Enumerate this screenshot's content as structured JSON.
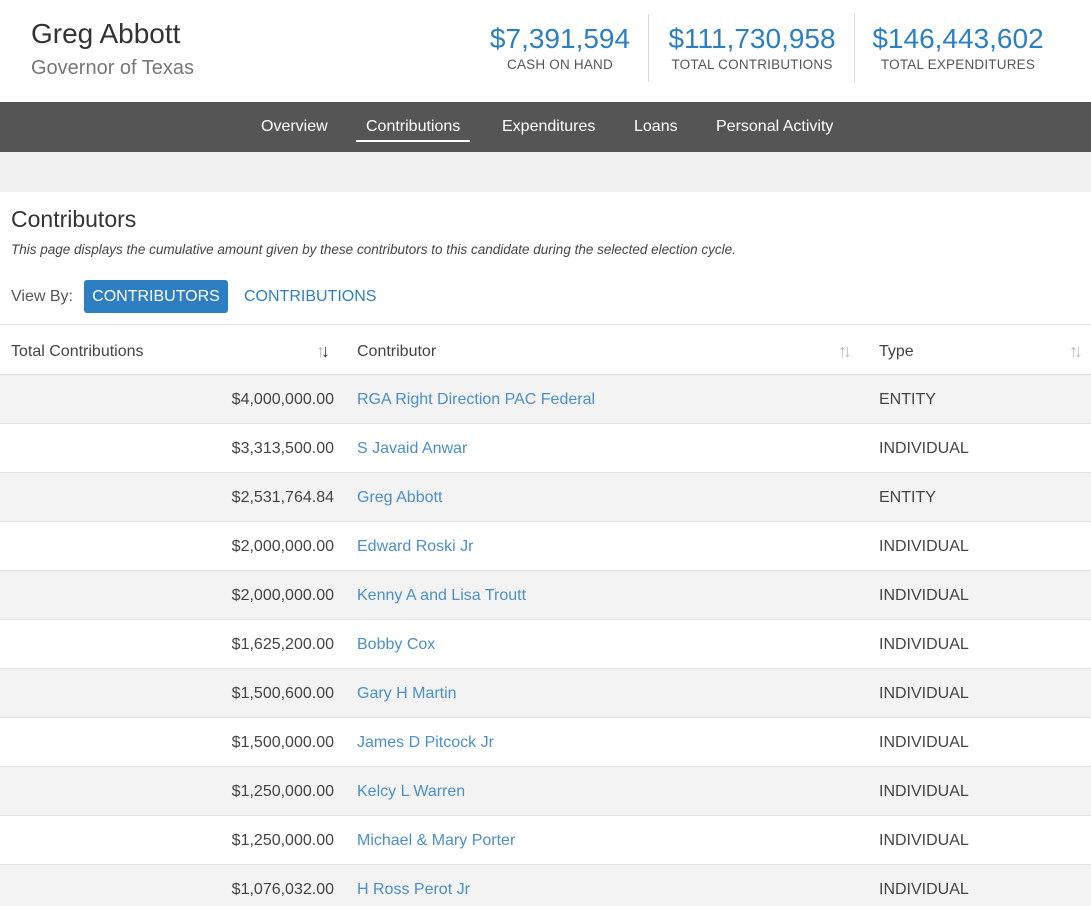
{
  "candidate": {
    "name": "Greg Abbott",
    "office": "Governor of Texas"
  },
  "stats": [
    {
      "amount": "$7,391,594",
      "label": "CASH ON HAND"
    },
    {
      "amount": "$111,730,958",
      "label": "TOTAL CONTRIBUTIONS"
    },
    {
      "amount": "$146,443,602",
      "label": "TOTAL EXPENDITURES"
    }
  ],
  "nav": {
    "items": [
      "Overview",
      "Contributions",
      "Expenditures",
      "Loans",
      "Personal Activity"
    ],
    "active": "Contributions"
  },
  "section": {
    "title": "Contributors",
    "description": "This page displays the cumulative amount given by these contributors to this candidate during the selected election cycle."
  },
  "view_by": {
    "label": "View By:",
    "active": "CONTRIBUTORS",
    "other": "CONTRIBUTIONS"
  },
  "table": {
    "headers": [
      "Total Contributions",
      "Contributor",
      "Type"
    ],
    "rows": [
      {
        "amount": "$4,000,000.00",
        "contributor": "RGA Right Direction PAC Federal",
        "type": "ENTITY"
      },
      {
        "amount": "$3,313,500.00",
        "contributor": "S Javaid Anwar",
        "type": "INDIVIDUAL"
      },
      {
        "amount": "$2,531,764.84",
        "contributor": "Greg Abbott",
        "type": "ENTITY"
      },
      {
        "amount": "$2,000,000.00",
        "contributor": "Edward Roski Jr",
        "type": "INDIVIDUAL"
      },
      {
        "amount": "$2,000,000.00",
        "contributor": "Kenny A and Lisa Troutt",
        "type": "INDIVIDUAL"
      },
      {
        "amount": "$1,625,200.00",
        "contributor": "Bobby Cox",
        "type": "INDIVIDUAL"
      },
      {
        "amount": "$1,500,600.00",
        "contributor": "Gary H Martin",
        "type": "INDIVIDUAL"
      },
      {
        "amount": "$1,500,000.00",
        "contributor": "James D Pitcock Jr",
        "type": "INDIVIDUAL"
      },
      {
        "amount": "$1,250,000.00",
        "contributor": "Kelcy L Warren",
        "type": "INDIVIDUAL"
      },
      {
        "amount": "$1,250,000.00",
        "contributor": "Michael & Mary Porter",
        "type": "INDIVIDUAL"
      },
      {
        "amount": "$1,076,032.00",
        "contributor": "H Ross Perot Jr",
        "type": "INDIVIDUAL"
      }
    ]
  },
  "colors": {
    "accent": "#2d7fc1",
    "link": "#4a8fca",
    "nav_bg": "#555555"
  }
}
